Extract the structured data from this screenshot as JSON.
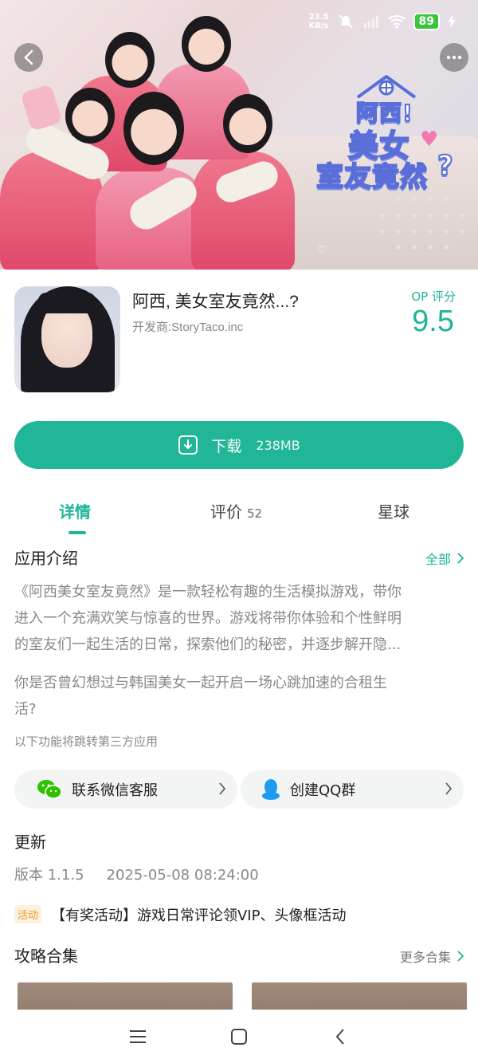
{
  "status_bar": {
    "net_speed_value": "23.5",
    "net_speed_unit": "KB/s",
    "battery": "89"
  },
  "banner": {
    "logo_line1": "阿西!",
    "logo_line2": "美女",
    "logo_line3": "室友竟然",
    "logo_q": "?"
  },
  "app": {
    "title": "阿西, 美女室友竟然...?",
    "developer": "开发商:StoryTaco.inc",
    "score_label": "OP 评分",
    "score": "9.5"
  },
  "download": {
    "label": "下载",
    "size": "238MB"
  },
  "tabs": [
    {
      "label": "详情",
      "active": true
    },
    {
      "label": "评价",
      "count": "52"
    },
    {
      "label": "星球"
    }
  ],
  "intro": {
    "title": "应用介绍",
    "all_label": "全部",
    "paragraph1_lines": [
      "《阿西美女室友竟然》是一款轻松有趣的生活模拟游戏，带你",
      "进入一个充满欢笑与惊喜的世界。游戏将带你体验和个性鲜明",
      "的室友们一起生活的日常，探索他们的秘密，并逐步解开隐..."
    ],
    "paragraph2_lines": [
      "你是否曾幻想过与韩国美女一起开启一场心跳加速的合租生",
      "活?"
    ],
    "third_party_note": "以下功能将跳转第三方应用"
  },
  "contacts": [
    {
      "label": "联系微信客服",
      "icon": "wechat-icon"
    },
    {
      "label": "创建QQ群",
      "icon": "qq-icon"
    }
  ],
  "update": {
    "title": "更新",
    "version": "版本 1.1.5",
    "date": "2025-05-08 08:24:00"
  },
  "event": {
    "tag": "活动",
    "text": "【有奖活动】游戏日常评论领VIP、头像框活动"
  },
  "guides": {
    "title": "攻略合集",
    "more_label": "更多合集"
  },
  "colors": {
    "accent": "#1fb59a",
    "event_orange": "#f09a2a"
  }
}
